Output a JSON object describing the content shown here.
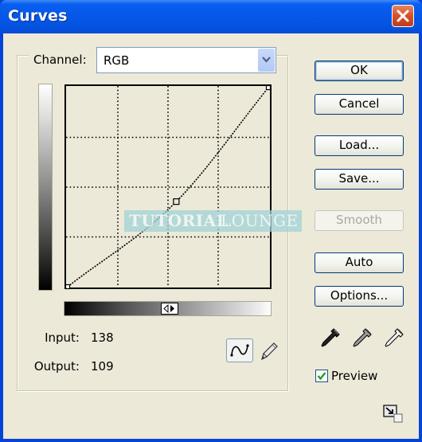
{
  "window": {
    "title": "Curves",
    "close_icon": "close-x-icon"
  },
  "channel": {
    "label": "Channel:",
    "selected": "RGB",
    "dropdown_icon": "chevron-down-icon"
  },
  "curve": {
    "points": [
      {
        "input": 0,
        "output": 0
      },
      {
        "input": 138,
        "output": 109
      },
      {
        "input": 255,
        "output": 255
      }
    ],
    "range": [
      0,
      255
    ],
    "grid_divisions": 4,
    "selected_point_index": 1
  },
  "readout": {
    "input_label": "Input:",
    "input_value": "138",
    "output_label": "Output:",
    "output_value": "109"
  },
  "tools": {
    "curve_tool_icon": "curve-icon",
    "pencil_tool_icon": "pencil-icon",
    "active": "curve"
  },
  "buttons": {
    "ok": "OK",
    "cancel": "Cancel",
    "load": "Load...",
    "save": "Save...",
    "smooth": "Smooth",
    "auto": "Auto",
    "options": "Options..."
  },
  "eyedroppers": [
    {
      "name": "black-point-eyedropper-icon"
    },
    {
      "name": "gray-point-eyedropper-icon"
    },
    {
      "name": "white-point-eyedropper-icon"
    }
  ],
  "preview": {
    "label": "Preview",
    "checked": true
  },
  "watermark": {
    "bold": "TUTORIAL",
    "light": "LOUNGE"
  }
}
